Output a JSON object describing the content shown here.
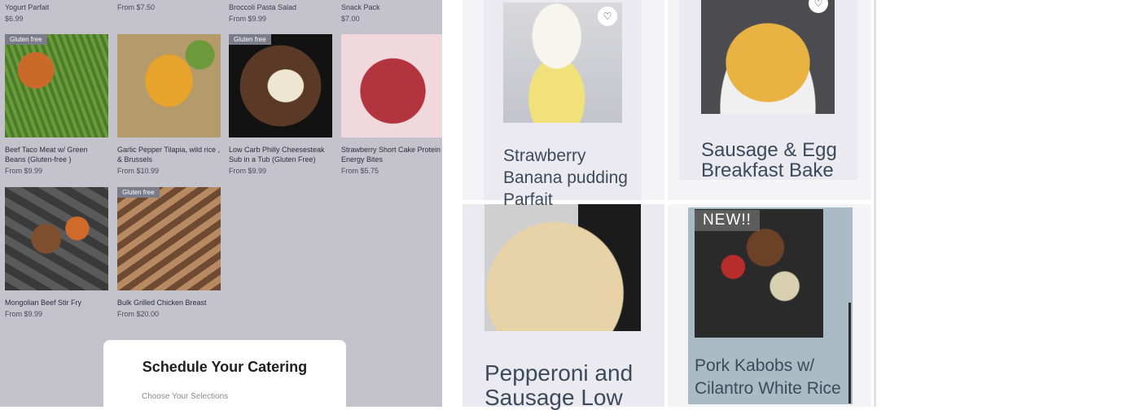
{
  "left_grid": {
    "top_row": [
      {
        "name": "Yogurt Parfait",
        "price": "$6.99"
      },
      {
        "name": "",
        "price": "From $7.50"
      },
      {
        "name": "Broccoli Pasta Salad",
        "price": "From $9.99"
      },
      {
        "name": "Snack Pack",
        "price": "$7.00"
      }
    ],
    "products": [
      {
        "name": "Beef Taco Meat w/ Green Beans (Gluten-free )",
        "price": "From $9.99",
        "badge": "Gluten free"
      },
      {
        "name": "Garlic Pepper Tilapia, wild rice , & Brussels",
        "price": "From $10.99",
        "badge": ""
      },
      {
        "name": "Low Carb Philly Cheesesteak Sub in a Tub (Gluten Free)",
        "price": "From $9.99",
        "badge": "Gluten free"
      },
      {
        "name": "Strawberry Short Cake Protein Energy Bites",
        "price": "From $5.75",
        "badge": ""
      },
      {
        "name": "Mongolian Beef Stir Fry",
        "price": "From $9.99",
        "badge": ""
      },
      {
        "name": "Bulk Grilled Chicken Breast",
        "price": "From $20.00",
        "badge": "Gluten free"
      }
    ]
  },
  "catering": {
    "title": "Schedule Your Catering",
    "subtitle": "Choose Your Selections"
  },
  "right_tiles": {
    "parfait": {
      "line1": "Strawberry",
      "line2": "Banana pudding",
      "line3": "Parfait"
    },
    "sausage": {
      "line1": "Sausage & Egg",
      "line2": "Breakfast Bake"
    },
    "pepperoni": {
      "line1": "Pepperoni and",
      "line2": "Sausage Low"
    },
    "kabobs": {
      "badge": "NEW!!",
      "line1": "Pork Kabobs w/",
      "line2": "Cilantro White Rice"
    }
  },
  "icons": {
    "heart": "heart-icon"
  },
  "colors": {
    "left_bg": "#c4c3cb",
    "badge_bg": "#7b7b8a",
    "title_text": "#3d4a5a"
  }
}
